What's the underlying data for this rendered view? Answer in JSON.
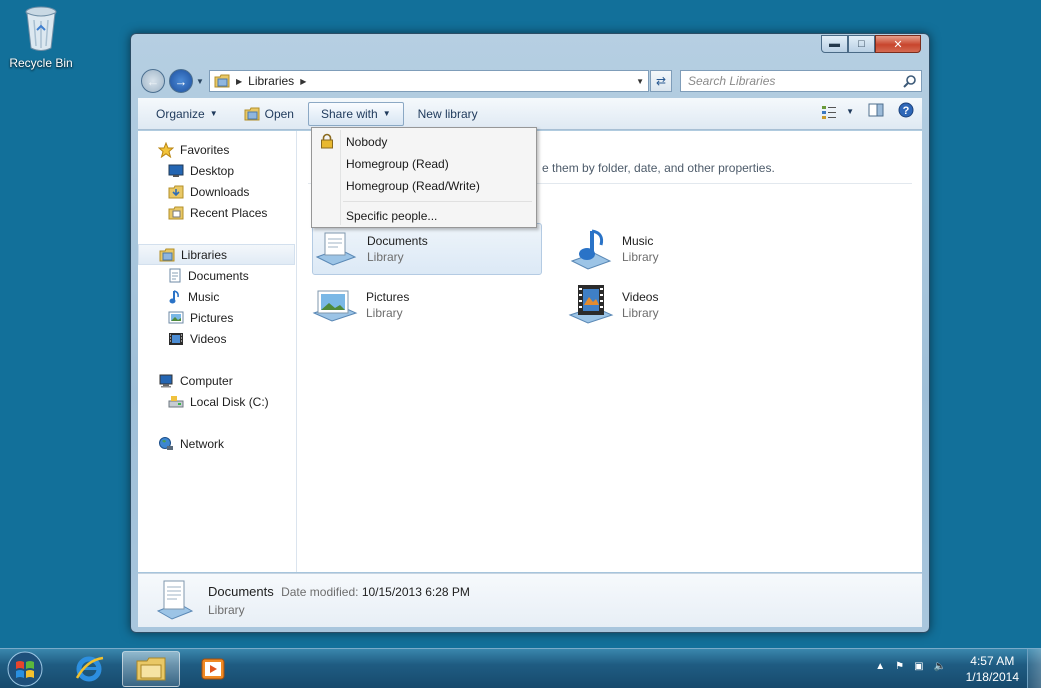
{
  "desktop": {
    "recycle_bin_label": "Recycle Bin"
  },
  "window": {
    "address": {
      "crumb": "Libraries"
    },
    "search": {
      "placeholder": "Search Libraries"
    },
    "toolbar": {
      "organize": "Organize",
      "open": "Open",
      "share_with": "Share with",
      "new_library": "New library"
    },
    "share_menu": {
      "items": [
        "Nobody",
        "Homegroup (Read)",
        "Homegroup (Read/Write)",
        "Specific people..."
      ]
    },
    "nav": {
      "favorites": "Favorites",
      "favorites_items": [
        "Desktop",
        "Downloads",
        "Recent Places"
      ],
      "libraries": "Libraries",
      "libraries_items": [
        "Documents",
        "Music",
        "Pictures",
        "Videos"
      ],
      "computer": "Computer",
      "computer_items": [
        "Local Disk (C:)"
      ],
      "network": "Network"
    },
    "content": {
      "hint": "e them by folder, date, and other properties.",
      "libraries": [
        {
          "name": "Documents",
          "type": "Library"
        },
        {
          "name": "Music",
          "type": "Library"
        },
        {
          "name": "Pictures",
          "type": "Library"
        },
        {
          "name": "Videos",
          "type": "Library"
        }
      ]
    },
    "details": {
      "name": "Documents",
      "date_label": "Date modified:",
      "date_value": "10/15/2013 6:28 PM",
      "type": "Library"
    }
  },
  "taskbar": {
    "time": "4:57 AM",
    "date": "1/18/2014"
  },
  "colors": {
    "desktop": "#12709a",
    "taskbar": "#1f5c82",
    "accent": "#1d4f9e"
  }
}
